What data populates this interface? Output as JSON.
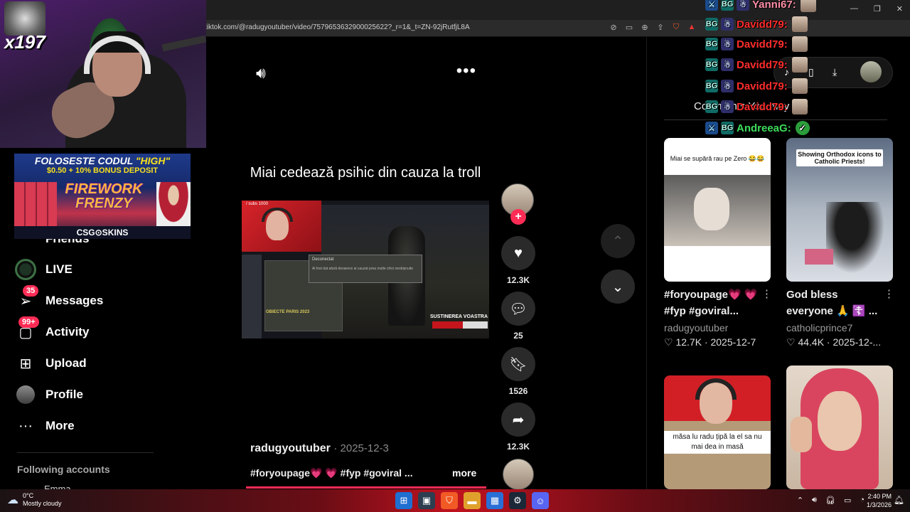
{
  "browser": {
    "url": "tiktok.com/@radugyoutuber/video/7579653632900025622?_r=1&_t=ZN-92jRutfjL8A",
    "toolbar_icons": [
      "eye-slash-icon",
      "screen-icon",
      "zoom-icon",
      "share-icon",
      "brave-shield-icon",
      "brave-rewards-icon"
    ],
    "window_controls": [
      "—",
      "❐",
      "✕"
    ]
  },
  "webcam": {
    "counter": "x197"
  },
  "ad": {
    "line1_prefix": "FOLOSESTE CODUL ",
    "line1_code": "\"HIGH\"",
    "line2": "$0.50 + 10% BONUS DEPOSIT",
    "game": "FIREWORK FRENZY",
    "footer": "CSG⊙SKINS"
  },
  "sidebar": {
    "friends_partial": "Friends",
    "items": [
      {
        "label": "LIVE",
        "icon": "live-icon"
      },
      {
        "label": "Messages",
        "icon": "messages-icon",
        "badge": "35"
      },
      {
        "label": "Activity",
        "icon": "activity-icon",
        "badge": "99+"
      },
      {
        "label": "Upload",
        "icon": "upload-icon"
      },
      {
        "label": "Profile",
        "icon": "profile-icon"
      },
      {
        "label": "More",
        "icon": "more-icon"
      }
    ],
    "following_title": "Following accounts",
    "following_item": "Emma"
  },
  "video": {
    "title": "Miai cedează psihic din cauza la troll",
    "stream_label": "/ subs 1000",
    "dialog_title": "Deconectat",
    "dialog_body": "Ai fost dat afară deoarece ai cauzat prea multe chici neobișnuite",
    "game_text": "OBIECTE PARIS 2023",
    "support_text": "SUSTINEREA VOASTRA",
    "support_progress": 0.55,
    "author": "radugyoutuber",
    "date": "2025-12-3",
    "description": "#foryoupage💗 💗 #fyp #goviral ...",
    "more": "more",
    "progress": 1.0
  },
  "actions": {
    "likes": "12.3K",
    "comments": "25",
    "saves": "1526",
    "shares": "12.3K"
  },
  "right_panel": {
    "tabs_text": "Comments          You may like",
    "cards": [
      {
        "thumb_caption": "Miai se supără rau pe Zero 😂😂",
        "caption_line1": "#foryoupage💗 💗",
        "caption_line2": "#fyp #goviral...",
        "author": "radugyoutuber",
        "stats": "♡ 12.7K  ·  2025-12-7"
      },
      {
        "thumb_caption": "Showing Orthodox icons to Catholic Priests!",
        "caption_line1": "God bless",
        "caption_line2": "everyone 🙏 ☦️ ...",
        "author": "catholicprince7",
        "stats": "♡ 44.4K  ·  2025-12-..."
      },
      {
        "thumb_caption": "măsa lu radu țipă la el sa nu mai dea in masă"
      },
      {}
    ]
  },
  "chat": [
    {
      "user": "Yanni67:",
      "color": "#ff8fa8",
      "badges": [
        "b-sword",
        "b-bg",
        "b-pal"
      ]
    },
    {
      "user": "Davidd79:",
      "color": "#ff2c2c",
      "badges": [
        "b-bg",
        "b-pal"
      ]
    },
    {
      "user": "Davidd79:",
      "color": "#ff2c2c",
      "badges": [
        "b-bg",
        "b-pal"
      ]
    },
    {
      "user": "Davidd79:",
      "color": "#ff2c2c",
      "badges": [
        "b-bg",
        "b-pal"
      ]
    },
    {
      "user": "Davidd79:",
      "color": "#ff2c2c",
      "badges": [
        "b-bg",
        "b-pal"
      ]
    },
    {
      "user": "Davidd79:",
      "color": "#ff2c2c",
      "badges": [
        "b-bg",
        "b-pal"
      ]
    },
    {
      "user": "AndreeaG:",
      "color": "#3ddc5a",
      "badges": [
        "b-sword",
        "b-bg"
      ]
    }
  ],
  "taskbar": {
    "temp": "0°C",
    "weather": "Mostly cloudy",
    "time": "2:40 PM",
    "date": "1/3/2026"
  }
}
